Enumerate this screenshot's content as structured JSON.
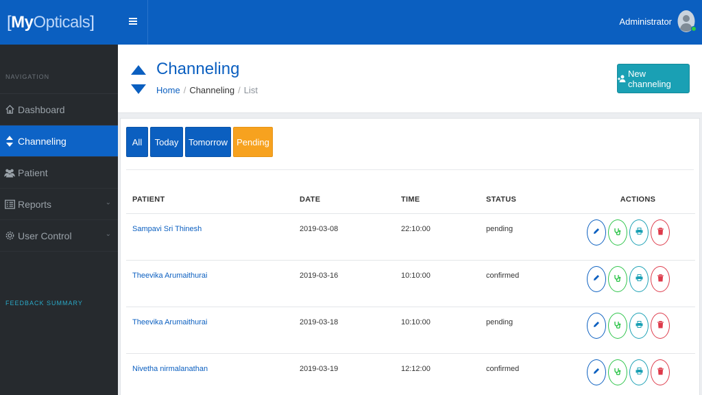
{
  "brand": {
    "bracket_open": "[",
    "part1": "My",
    "part2": "Opticals",
    "bracket_close": "]"
  },
  "header": {
    "user_name": "Administrator"
  },
  "sidebar": {
    "heading": "NAVIGATION",
    "items": [
      {
        "label": "Dashboard",
        "icon": "home-icon"
      },
      {
        "label": "Channeling",
        "icon": "sort-icon"
      },
      {
        "label": "Patient",
        "icon": "users-icon"
      },
      {
        "label": "Reports",
        "icon": "list-icon"
      },
      {
        "label": "User Control",
        "icon": "gear-icon"
      }
    ],
    "feedback": "FEEDBACK SUMMARY"
  },
  "page": {
    "title": "Channeling",
    "breadcrumb": [
      "Home",
      "Channeling",
      "List"
    ],
    "new_button": "New channeling"
  },
  "filters": [
    "All",
    "Today",
    "Tomorrow",
    "Pending"
  ],
  "table": {
    "headers": [
      "PATIENT",
      "DATE",
      "TIME",
      "STATUS",
      "ACTIONS"
    ],
    "rows": [
      {
        "patient": "Sampavi Sri Thinesh",
        "date": "2019-03-08",
        "time": "22:10:00",
        "status": "pending"
      },
      {
        "patient": "Theevika Arumaithurai",
        "date": "2019-03-16",
        "time": "10:10:00",
        "status": "confirmed"
      },
      {
        "patient": "Theevika Arumaithurai",
        "date": "2019-03-18",
        "time": "10:10:00",
        "status": "pending"
      },
      {
        "patient": "Nivetha nirmalanathan",
        "date": "2019-03-19",
        "time": "12:12:00",
        "status": "confirmed"
      }
    ]
  },
  "colors": {
    "primary": "#0b5fc0",
    "teal": "#1aa0b4",
    "orange": "#f7a21f",
    "green": "#2ec44a",
    "red": "#dd3a4a",
    "sidebar": "#262a2e"
  }
}
